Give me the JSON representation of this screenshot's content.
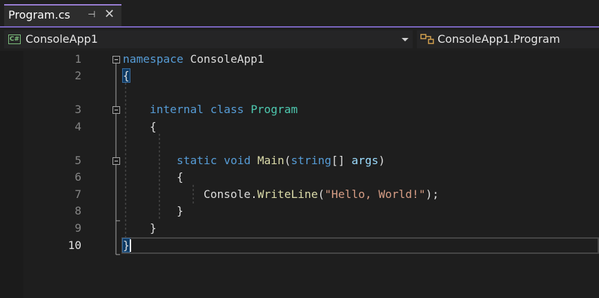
{
  "tab": {
    "title": "Program.cs",
    "pin_icon": "pin-icon",
    "close_icon": "close-icon"
  },
  "nav": {
    "project_icon": "csharp-project-icon",
    "project_icon_text": "C#",
    "project": "ConsoleApp1",
    "member_icon": "class-icon",
    "member": "ConsoleApp1.Program"
  },
  "editor": {
    "current_line": 10,
    "lines": [
      {
        "num": "1",
        "tokens": [
          {
            "t": "namespace",
            "c": "kw"
          },
          {
            "t": " ConsoleApp1",
            "c": ""
          }
        ]
      },
      {
        "num": "2",
        "tokens": [
          {
            "t": "{",
            "c": "brace-hl"
          }
        ]
      },
      {
        "num": "",
        "tokens": []
      },
      {
        "num": "3",
        "tokens": [
          {
            "t": "    ",
            "c": ""
          },
          {
            "t": "internal",
            "c": "kw"
          },
          {
            "t": " ",
            "c": ""
          },
          {
            "t": "class",
            "c": "kw"
          },
          {
            "t": " ",
            "c": ""
          },
          {
            "t": "Program",
            "c": "typ"
          }
        ]
      },
      {
        "num": "4",
        "tokens": [
          {
            "t": "    {",
            "c": ""
          }
        ]
      },
      {
        "num": "",
        "tokens": []
      },
      {
        "num": "5",
        "tokens": [
          {
            "t": "        ",
            "c": ""
          },
          {
            "t": "static",
            "c": "kw"
          },
          {
            "t": " ",
            "c": ""
          },
          {
            "t": "void",
            "c": "kw"
          },
          {
            "t": " ",
            "c": ""
          },
          {
            "t": "Main",
            "c": "fn"
          },
          {
            "t": "(",
            "c": ""
          },
          {
            "t": "string",
            "c": "kw"
          },
          {
            "t": "[] ",
            "c": ""
          },
          {
            "t": "args",
            "c": "prm"
          },
          {
            "t": ")",
            "c": ""
          }
        ]
      },
      {
        "num": "6",
        "tokens": [
          {
            "t": "        {",
            "c": ""
          }
        ]
      },
      {
        "num": "7",
        "tokens": [
          {
            "t": "            Console.",
            "c": ""
          },
          {
            "t": "WriteLine",
            "c": "fn"
          },
          {
            "t": "(",
            "c": ""
          },
          {
            "t": "\"Hello, World!\"",
            "c": "str"
          },
          {
            "t": ");",
            "c": ""
          }
        ]
      },
      {
        "num": "8",
        "tokens": [
          {
            "t": "        }",
            "c": ""
          }
        ]
      },
      {
        "num": "9",
        "tokens": [
          {
            "t": "    }",
            "c": ""
          }
        ]
      },
      {
        "num": "10",
        "tokens": [
          {
            "t": "}",
            "c": "brace-hl"
          }
        ]
      }
    ]
  },
  "colors": {
    "keyword": "#569cd6",
    "type": "#4ec9b0",
    "method": "#dcdcaa",
    "string": "#d69d85",
    "parameter": "#9cdcfe",
    "accent": "#7a66c0"
  }
}
